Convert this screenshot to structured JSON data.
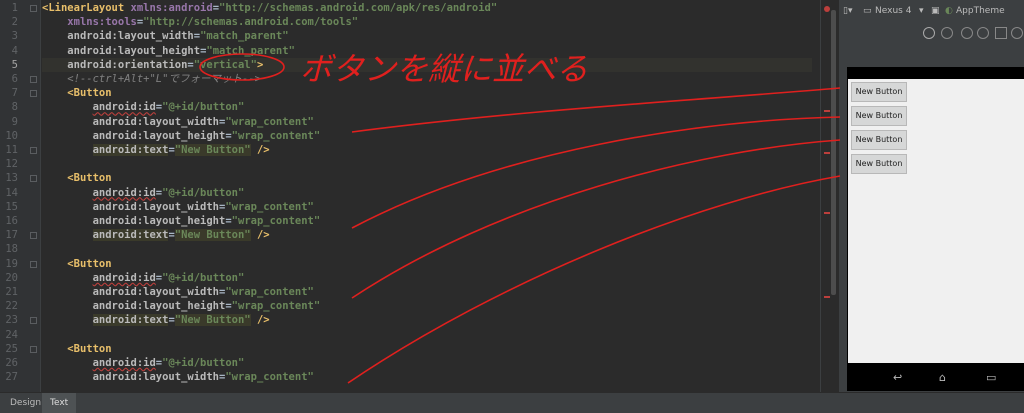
{
  "editor": {
    "lines": [
      {
        "n": "1",
        "html": "<span class=\"tag\">&lt;LinearLayout</span> <span class=\"ns\">xmlns:android</span>=<span class=\"val\">\"http://schemas.android.com/apk/res/android\"</span>"
      },
      {
        "n": "2",
        "html": "    <span class=\"ns\">xmlns:tools</span>=<span class=\"val\">\"http://schemas.android.com/tools\"</span>"
      },
      {
        "n": "3",
        "html": "    <span class=\"attr\">android:layout_width</span>=<span class=\"val\">\"match_parent\"</span>"
      },
      {
        "n": "4",
        "html": "    <span class=\"attr\">android:layout_height</span>=<span class=\"val\">\"match_parent\"</span>"
      },
      {
        "n": "5",
        "html": "    <span class=\"attr\">android:orientation</span>=<span class=\"val\">\"vertical\"</span><span class=\"tag\">&gt;</span>"
      },
      {
        "n": "6",
        "html": "    <span class=\"cmt\">&lt;!--ctrl+Alt+\"L\"でフォーマット--&gt;</span>"
      },
      {
        "n": "7",
        "html": "    <span class=\"tag\">&lt;Button</span>"
      },
      {
        "n": "8",
        "html": "        <span class=\"attr err\">android:id</span>=<span class=\"val\">\"@+id/button\"</span>"
      },
      {
        "n": "9",
        "html": "        <span class=\"attr\">android:layout_width</span>=<span class=\"val\">\"wrap_content\"</span>"
      },
      {
        "n": "10",
        "html": "        <span class=\"attr\">android:layout_height</span>=<span class=\"val\">\"wrap_content\"</span>"
      },
      {
        "n": "11",
        "html": "        <span class=\"attr hl\">android:text</span>=<span class=\"val hl\">\"New Button\"</span> <span class=\"tag\">/&gt;</span>"
      },
      {
        "n": "12",
        "html": ""
      },
      {
        "n": "13",
        "html": "    <span class=\"tag\">&lt;Button</span>"
      },
      {
        "n": "14",
        "html": "        <span class=\"attr err\">android:id</span>=<span class=\"val\">\"@+id/button\"</span>"
      },
      {
        "n": "15",
        "html": "        <span class=\"attr\">android:layout_width</span>=<span class=\"val\">\"wrap_content\"</span>"
      },
      {
        "n": "16",
        "html": "        <span class=\"attr\">android:layout_height</span>=<span class=\"val\">\"wrap_content\"</span>"
      },
      {
        "n": "17",
        "html": "        <span class=\"attr hl\">android:text</span>=<span class=\"val hl\">\"New Button\"</span> <span class=\"tag\">/&gt;</span>"
      },
      {
        "n": "18",
        "html": ""
      },
      {
        "n": "19",
        "html": "    <span class=\"tag\">&lt;Button</span>"
      },
      {
        "n": "20",
        "html": "        <span class=\"attr err\">android:id</span>=<span class=\"val\">\"@+id/button\"</span>"
      },
      {
        "n": "21",
        "html": "        <span class=\"attr\">android:layout_width</span>=<span class=\"val\">\"wrap_content\"</span>"
      },
      {
        "n": "22",
        "html": "        <span class=\"attr\">android:layout_height</span>=<span class=\"val\">\"wrap_content\"</span>"
      },
      {
        "n": "23",
        "html": "        <span class=\"attr hl\">android:text</span>=<span class=\"val hl\">\"New Button\"</span> <span class=\"tag\">/&gt;</span>"
      },
      {
        "n": "24",
        "html": ""
      },
      {
        "n": "25",
        "html": "    <span class=\"tag\">&lt;Button</span>"
      },
      {
        "n": "26",
        "html": "        <span class=\"attr err\">android:id</span>=<span class=\"val\">\"@+id/button\"</span>"
      },
      {
        "n": "27",
        "html": "        <span class=\"attr\">android:layout_width</span>=<span class=\"val\">\"wrap_content\"</span>"
      }
    ],
    "fold_lines": [
      1,
      6,
      7,
      11,
      13,
      17,
      19,
      23,
      25
    ]
  },
  "annotation_text": "ボタンを縦に並べる",
  "preview": {
    "device_label": "Nexus 4",
    "theme_label": "AppTheme",
    "buttons": [
      "New Button",
      "New Button",
      "New Button",
      "New Button"
    ]
  },
  "tabs": [
    {
      "label": "Design"
    },
    {
      "label": "Text"
    }
  ],
  "colors": {
    "editor_bg": "#2b2b2b",
    "annotation": "#e0201e",
    "tag": "#e8bf6a",
    "value": "#6a8759"
  }
}
